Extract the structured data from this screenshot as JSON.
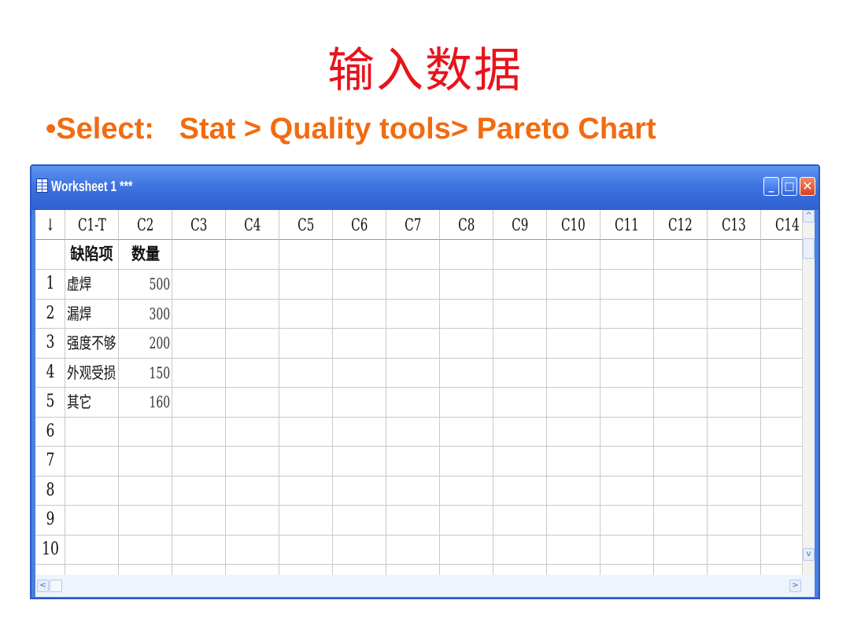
{
  "slide": {
    "title": "输入数据",
    "bullet": "•Select:   Stat > Quality tools> Pareto Chart"
  },
  "window": {
    "title": "Worksheet 1 ***"
  },
  "worksheet": {
    "corner_symbol": "↓",
    "columns": [
      "C1-T",
      "C2",
      "C3",
      "C4",
      "C5",
      "C6",
      "C7",
      "C8",
      "C9",
      "C10",
      "C11",
      "C12",
      "C13",
      "C14"
    ],
    "column_names": [
      "缺陷项",
      "数量"
    ],
    "row_numbers": [
      "1",
      "2",
      "3",
      "4",
      "5",
      "6",
      "7",
      "8",
      "9",
      "10"
    ],
    "rows": [
      {
        "defect": "虚焊",
        "qty": "500"
      },
      {
        "defect": "漏焊",
        "qty": "300"
      },
      {
        "defect": "强度不够",
        "qty": "200"
      },
      {
        "defect": "外观受损",
        "qty": "150"
      },
      {
        "defect": "其它",
        "qty": "160"
      }
    ]
  },
  "scrollbars": {
    "up_arrow": "^",
    "down_arrow": "v",
    "left_arrow": "<",
    "right_arrow": ">"
  }
}
